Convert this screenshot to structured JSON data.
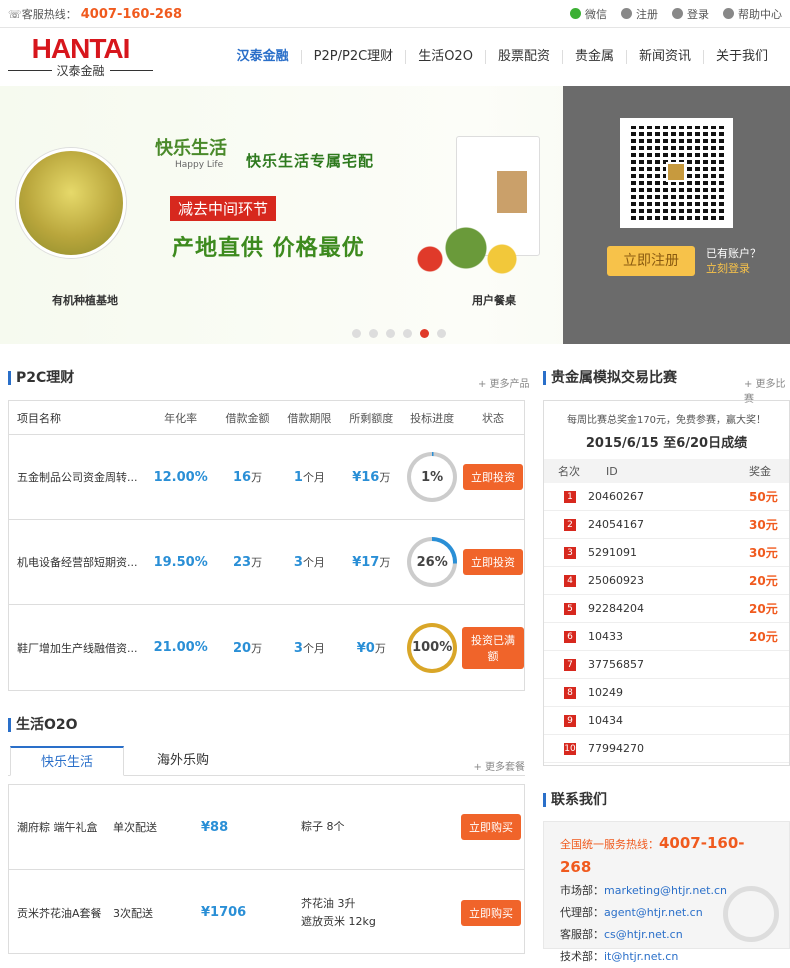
{
  "topbar": {
    "hotline_label": "客服热线：",
    "hotline": "4007-160-268",
    "wechat": "微信",
    "register": "注册",
    "login": "登录",
    "help": "帮助中心"
  },
  "logo": {
    "en": "HANTAI",
    "cn": "汉泰金融"
  },
  "nav": [
    "汉泰金融",
    "P2P/P2C理财",
    "生活O2O",
    "股票配资",
    "贵金属",
    "新闻资讯",
    "关于我们"
  ],
  "banner": {
    "brand": "快乐生活",
    "brand_en": "Happy Life",
    "headline": "快乐生活专属宅配",
    "tag": "减去中间环节",
    "slogan": "产地直供  价格最优",
    "left_caption": "有机种植基地",
    "right_caption": "用户餐桌",
    "register_button": "立即注册",
    "has_account": "已有账户？",
    "login_now": "立刻登录",
    "active_dot": 4
  },
  "p2c": {
    "title": "P2C理财",
    "more": "+ 更多产品",
    "headers": [
      "项目名称",
      "年化率",
      "借款金额",
      "借款期限",
      "所剩额度",
      "投标进度",
      "状态"
    ],
    "rows": [
      {
        "name": "五金制品公司资金周转...",
        "rate": "12.00%",
        "amount": "16",
        "amount_unit": "万",
        "term": "1",
        "term_unit": "个月",
        "remain": "¥16",
        "remain_unit": "万",
        "progress": "1%",
        "progress_value": 1,
        "status": "立即投资"
      },
      {
        "name": "机电设备经营部短期资...",
        "rate": "19.50%",
        "amount": "23",
        "amount_unit": "万",
        "term": "3",
        "term_unit": "个月",
        "remain": "¥17",
        "remain_unit": "万",
        "progress": "26%",
        "progress_value": 26,
        "status": "立即投资"
      },
      {
        "name": "鞋厂增加生产线融借资...",
        "rate": "21.00%",
        "amount": "20",
        "amount_unit": "万",
        "term": "3",
        "term_unit": "个月",
        "remain": "¥0",
        "remain_unit": "万",
        "progress": "100%",
        "progress_value": 100,
        "status": "投资已满额"
      }
    ]
  },
  "o2o": {
    "title": "生活O2O",
    "tab1": "快乐生活",
    "tab2": "海外乐购",
    "more": "+ 更多套餐",
    "rows": [
      {
        "name": "潮府粽 端午礼盒",
        "delivery": "单次配送",
        "price": "¥88",
        "content1": "粽子 8个",
        "content2": "",
        "button": "立即购买"
      },
      {
        "name": "贡米芥花油A套餐",
        "delivery": "3次配送",
        "price": "¥1706",
        "content1": "芥花油 3升",
        "content2": "遮放贡米 12kg",
        "button": "立即购买"
      }
    ]
  },
  "contest": {
    "title": "贵金属模拟交易比赛",
    "more": "+ 更多比赛",
    "info": "每周比赛总奖金170元，免费参赛，赢大奖！",
    "date": "2015/6/15 至6/20日成绩",
    "headers": [
      "名次",
      "ID",
      "奖金"
    ],
    "rows": [
      {
        "rank": "1",
        "id": "20460267",
        "prize": "50元"
      },
      {
        "rank": "2",
        "id": "24054167",
        "prize": "30元"
      },
      {
        "rank": "3",
        "id": "5291091",
        "prize": "30元"
      },
      {
        "rank": "4",
        "id": "25060923",
        "prize": "20元"
      },
      {
        "rank": "5",
        "id": "92284204",
        "prize": "20元"
      },
      {
        "rank": "6",
        "id": "10433",
        "prize": "20元"
      },
      {
        "rank": "7",
        "id": "37756857",
        "prize": ""
      },
      {
        "rank": "8",
        "id": "10249",
        "prize": ""
      },
      {
        "rank": "9",
        "id": "10434",
        "prize": ""
      },
      {
        "rank": "10",
        "id": "77994270",
        "prize": ""
      }
    ]
  },
  "contact": {
    "title": "联系我们",
    "hotline_label": "全国统一服务热线：",
    "hotline": "4007-160-268",
    "lines": [
      {
        "label": "市场部：",
        "email": "marketing@htjr.net.cn"
      },
      {
        "label": "代理部：",
        "email": "agent@htjr.net.cn"
      },
      {
        "label": "客服部：",
        "email": "cs@htjr.net.cn"
      },
      {
        "label": "技术部：",
        "email": "it@htjr.net.cn"
      }
    ]
  }
}
